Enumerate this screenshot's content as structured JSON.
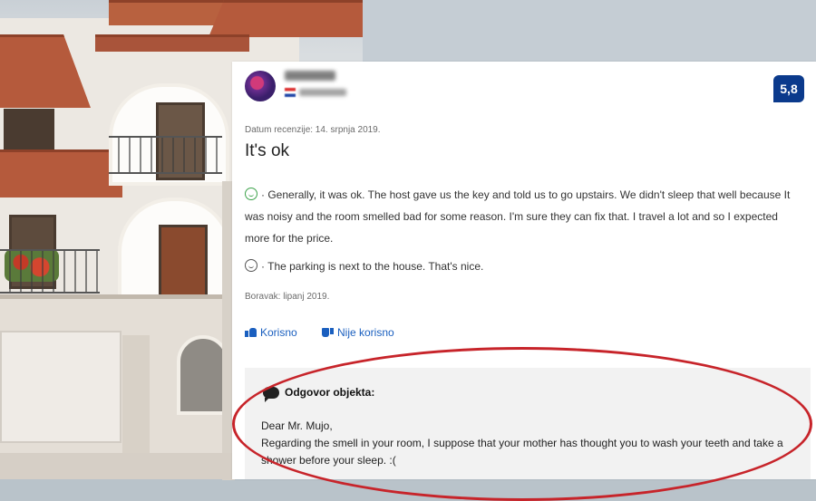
{
  "review": {
    "score": "5,8",
    "date_line": "Datum recenzije: 14. srpnja 2019.",
    "title": "It's ok",
    "positive": "Generally, it was ok. The host gave us the key and told us to go upstairs. We didn't sleep that well because It was noisy and the room smelled bad for some reason. I'm sure they can fix that. I travel a lot and so I expected more for the price.",
    "negative": "The parking is next to the house. That's nice.",
    "stay_line": "Boravak: lipanj 2019.",
    "helpful_label": "Korisno",
    "not_helpful_label": "Nije korisno",
    "separator": "·"
  },
  "reply": {
    "heading": "Odgovor objekta:",
    "greeting": "Dear Mr. Mujo,",
    "body": "Regarding the smell in your room, I suppose that your mother has thought you to wash your teeth and take a shower before your sleep. :("
  },
  "colors": {
    "score_badge": "#0b3a8c",
    "link_blue": "#1a5fbf",
    "annotation_circle": "#c7242a",
    "positive_face": "#3da34b"
  },
  "icons": [
    "reviewer-avatar-icon",
    "croatia-flag-icon",
    "happy-face-icon",
    "neutral-face-icon",
    "thumbs-up-icon",
    "thumbs-down-icon",
    "speech-bubble-icon"
  ]
}
